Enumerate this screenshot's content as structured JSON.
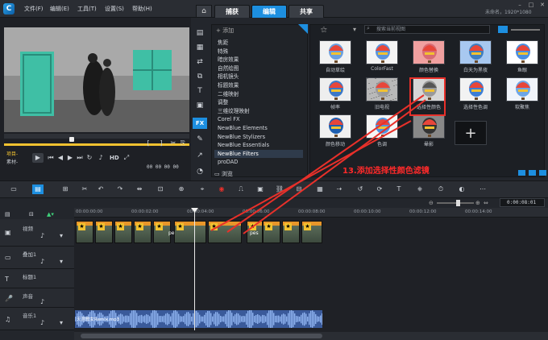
{
  "app": {
    "logo": "C",
    "menu": [
      "文件(F)",
      "编辑(E)",
      "工具(T)",
      "设置(S)",
      "帮助(H)"
    ],
    "tabs": [
      "捕获",
      "编辑",
      "共享"
    ],
    "active_tab": "编辑",
    "project_title": "未命名，1920*1080"
  },
  "preview": {
    "mode_project": "项目-",
    "mode_clip": "素材-",
    "hd": "HD",
    "timecode": "00 00 00 00"
  },
  "library": {
    "add_label": "添加",
    "categories": [
      "焦距",
      "特殊",
      "暗房效果",
      "自然绘图",
      "相机镜头",
      "标题效果",
      "二维映射",
      "调整",
      "三维纹理映射",
      "Corel FX",
      "NewBlue Elements",
      "NewBlue Stylizers",
      "NewBlue Essentials",
      "NewBlue Filters",
      "proDAD"
    ],
    "selected_category": "NewBlue Filters",
    "browse_label": "浏览",
    "search_placeholder": "搜索当前视图",
    "filters": [
      "自动草绘",
      "ColorFast",
      "颜色替换",
      "白天为黑夜",
      "鱼眼",
      "帧率",
      "旧电视",
      "选择性颜色",
      "选择性色调",
      "软聚焦",
      "颜色移动",
      "色调",
      "晕影"
    ],
    "selected_filter": "选择性颜色"
  },
  "annotation": "13.添加选择性颜色滤镜",
  "timeline": {
    "ruler_times": [
      "00:00:00:00",
      "00:00:02:00",
      "00:00:04:00",
      "00:00:06:00",
      "00:00:08:00",
      "00:00:10:00",
      "00:00:12:00",
      "00:00:14:00"
    ],
    "zoom_time": "0:00:08:01",
    "tracks": [
      {
        "name": "视频"
      },
      {
        "name": "叠加1"
      },
      {
        "name": "标题1"
      },
      {
        "name": "声音"
      },
      {
        "name": "音乐1"
      }
    ],
    "clip_labels": [
      "pe",
      "pes"
    ],
    "audio_clip": "天涯歌女Remix.mp3"
  },
  "colors": {
    "accent": "#1d8fe0",
    "highlight": "#e8302a",
    "annotation": "#ff2a2a",
    "clip_orange": "#e8962a",
    "audio_blue": "#3a5a9a",
    "playbar": "#f2c230"
  },
  "icons": [
    "home-icon",
    "fx-icon",
    "search-icon",
    "plus-icon",
    "play-icon",
    "undo-icon",
    "redo-icon",
    "speaker-icon",
    "lock-icon"
  ]
}
